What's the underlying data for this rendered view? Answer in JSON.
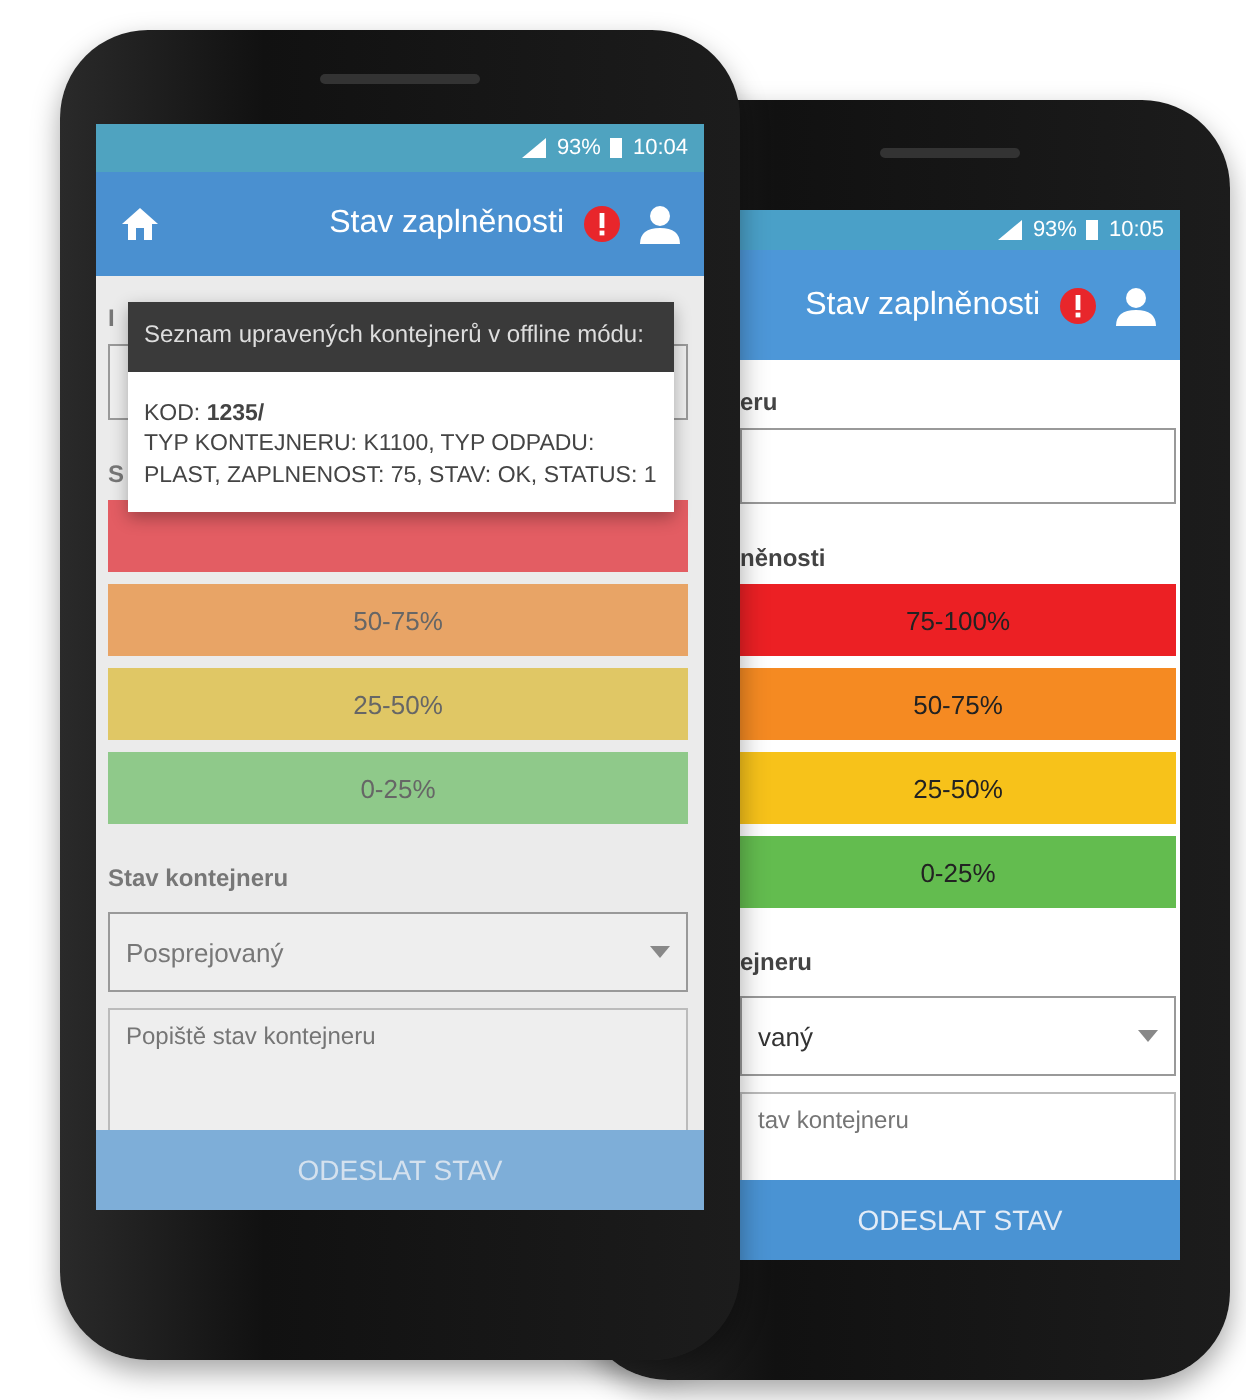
{
  "phones": [
    {
      "home": true,
      "status_bar": {
        "battery": "93%",
        "time": "10:04"
      },
      "title": "Stav zaplněnosti",
      "content": [
        {
          "kind": "label",
          "text": "I"
        },
        {
          "kind": "field"
        },
        {
          "kind": "label",
          "text": "S"
        },
        {
          "kind": "bar",
          "color": "#e35d63"
        },
        {
          "kind": "bar",
          "label": "50-75%",
          "color": "#e8a466"
        },
        {
          "kind": "bar",
          "label": "25-50%",
          "color": "#e0c765"
        },
        {
          "kind": "bar",
          "label": "0-25%",
          "color": "#8fc98a"
        },
        {
          "kind": "label",
          "text": "Stav kontejneru"
        },
        {
          "kind": "select",
          "value": "Posprejovaný"
        },
        {
          "kind": "textarea",
          "placeholder": "Popiště stav kontejneru"
        }
      ],
      "button": "ODESLAT STAV",
      "dialog": {
        "title": "Seznam upravených kontejnerů v offline módu:",
        "lines": [
          "KOD: **1235/**",
          "TYP KONTEJNERU: K1100, TYP ODPADU: PLAST, ZAPLNENOST: 75, STAV: OK, STATUS: 1"
        ]
      }
    },
    {
      "home": false,
      "status_bar": {
        "battery": "93%",
        "time": "10:05"
      },
      "title": "Stav zaplněnosti",
      "content": [
        {
          "kind": "label",
          "text": "eru"
        },
        {
          "kind": "field"
        },
        {
          "kind": "label",
          "text": "něnosti"
        },
        {
          "kind": "bar",
          "label": "75-100%",
          "color": "#ec2024"
        },
        {
          "kind": "bar",
          "label": "50-75%",
          "color": "#f58a22"
        },
        {
          "kind": "bar",
          "label": "25-50%",
          "color": "#f7c21a"
        },
        {
          "kind": "bar",
          "label": "0-25%",
          "color": "#63bc4f"
        },
        {
          "kind": "label",
          "text": "ejneru"
        },
        {
          "kind": "select",
          "value": "vaný"
        },
        {
          "kind": "textarea",
          "placeholder": "tav kontejneru"
        }
      ],
      "button": "ODESLAT STAV"
    }
  ]
}
